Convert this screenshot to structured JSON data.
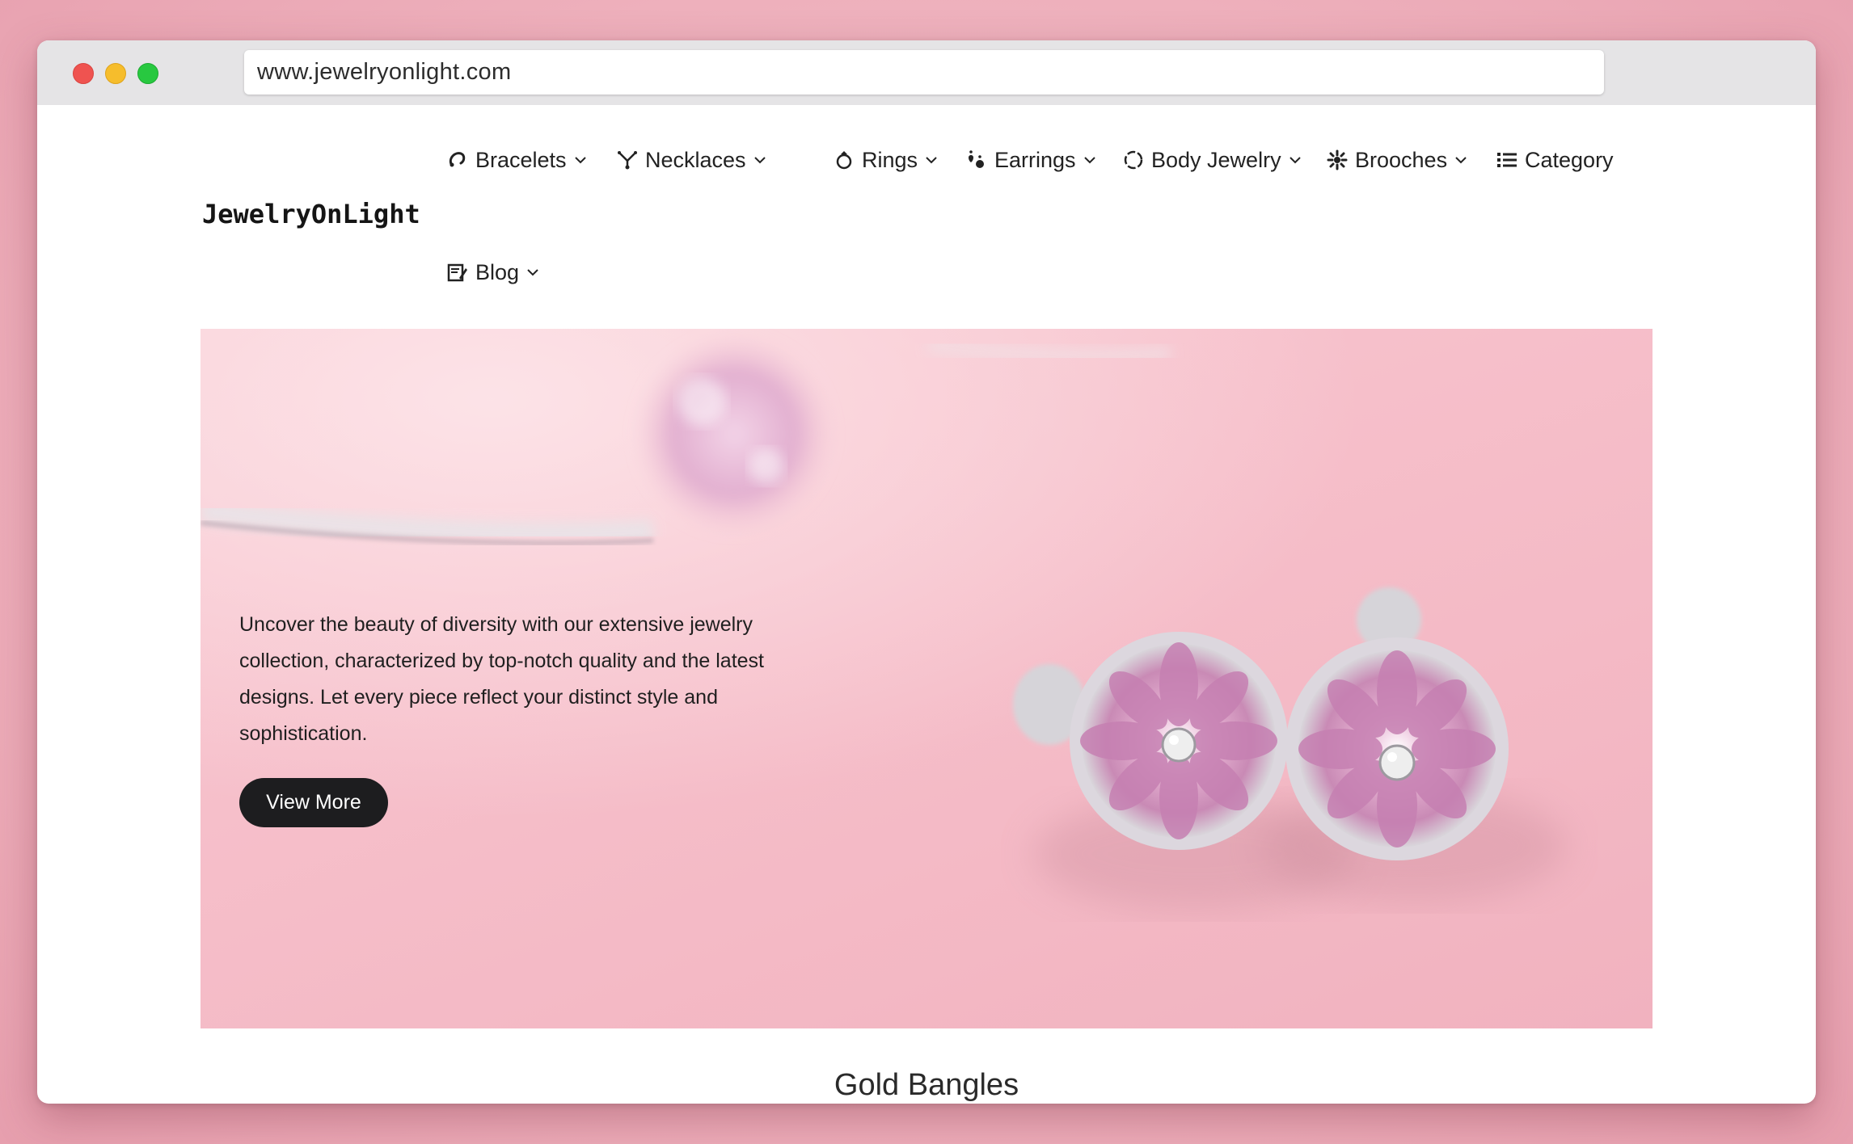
{
  "browser": {
    "url": "www.jewelryonlight.com"
  },
  "site": {
    "logo": "JewelryOnLight"
  },
  "nav": {
    "items": [
      {
        "label": "Bracelets",
        "icon": "bracelet-icon"
      },
      {
        "label": "Necklaces",
        "icon": "necklace-icon"
      },
      {
        "label": "Rings",
        "icon": "ring-icon"
      },
      {
        "label": "Earrings",
        "icon": "earrings-icon"
      },
      {
        "label": "Body Jewelry",
        "icon": "body-jewelry-icon"
      },
      {
        "label": "Brooches",
        "icon": "brooch-icon"
      },
      {
        "label": "Category",
        "icon": "list-icon"
      },
      {
        "label": "Blog",
        "icon": "blog-icon"
      }
    ]
  },
  "hero": {
    "text": "Uncover the beauty of diversity with our extensive jewelry collection, characterized by top-notch quality and the latest designs. Let every piece reflect your distinct style and sophistication.",
    "button_label": "View More"
  },
  "section": {
    "title": "Gold Bangles"
  },
  "colors": {
    "background": "#eeb0bc",
    "hero_pink": "#f6bfca",
    "button": "#1d1d1f",
    "text": "#222222"
  }
}
